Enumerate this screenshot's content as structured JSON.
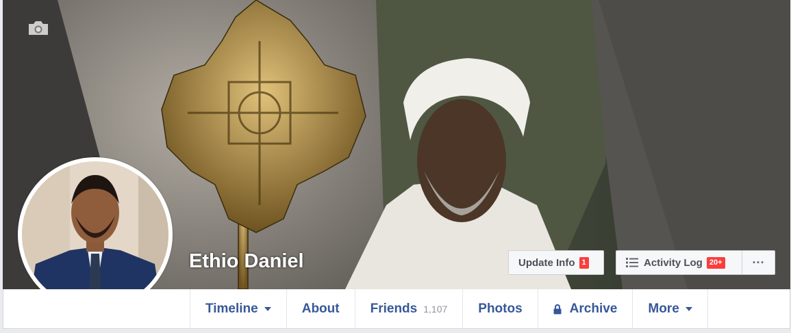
{
  "profile": {
    "name": "Ethio Daniel"
  },
  "cover": {
    "camera_icon": "camera-icon"
  },
  "actions": {
    "update_info_label": "Update Info",
    "update_info_badge": "1",
    "activity_log_label": "Activity Log",
    "activity_log_badge": "20+",
    "more_options_label": "···"
  },
  "tabs": [
    {
      "label": "Timeline",
      "has_caret": true
    },
    {
      "label": "About"
    },
    {
      "label": "Friends",
      "count": "1,107"
    },
    {
      "label": "Photos"
    },
    {
      "label": "Archive",
      "icon": "lock-icon"
    },
    {
      "label": "More",
      "has_caret": true
    }
  ],
  "colors": {
    "link": "#365899",
    "badge": "#fa3e3e",
    "page_bg": "#e9ebee"
  }
}
